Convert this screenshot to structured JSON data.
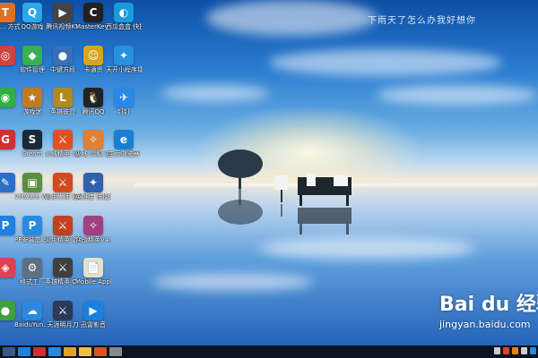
{
  "wallpaper_text": "下雨天了怎么办我好想你",
  "watermark": {
    "brand": "Bai du 经验",
    "site": "jingyan.baidu.com"
  },
  "desktop_icons": [
    {
      "label": "Tra... 方式",
      "color": "#e07020",
      "glyph": "T"
    },
    {
      "label": "QQ游戏",
      "color": "#2aa8e8",
      "glyph": "Q"
    },
    {
      "label": "腾讯视频KV",
      "color": "#444",
      "glyph": "▶"
    },
    {
      "label": "MasterKey 方式",
      "color": "#222",
      "glyph": "C"
    },
    {
      "label": "西瓜盒盒 快捷方式",
      "color": "#1a9ad9",
      "glyph": "◐"
    },
    {
      "label": "",
      "color": "#d04040",
      "glyph": "◎"
    },
    {
      "label": "软件管理",
      "color": "#38b050",
      "glyph": "◆"
    },
    {
      "label": "中键方段",
      "color": "#3a6fb6",
      "glyph": "●"
    },
    {
      "label": "卡通资",
      "color": "#d9a520",
      "glyph": "☺"
    },
    {
      "label": "天开小程序捷",
      "color": "#2890e0",
      "glyph": "✦"
    },
    {
      "label": "",
      "color": "#30b040",
      "glyph": "◉"
    },
    {
      "label": "游戏迷",
      "color": "#c07a20",
      "glyph": "★"
    },
    {
      "label": "英雄联盟",
      "color": "#b08a20",
      "glyph": "L"
    },
    {
      "label": "腾讯QQ",
      "color": "#222",
      "glyph": "🐧"
    },
    {
      "label": "钉钉",
      "color": "#2a88e8",
      "glyph": "✈"
    },
    {
      "label": "",
      "color": "#d03030",
      "glyph": "G"
    },
    {
      "label": "Steam",
      "color": "#1b2838",
      "glyph": "S"
    },
    {
      "label": "火线精英 (游戏)",
      "color": "#e05020",
      "glyph": "⚔"
    },
    {
      "label": "火线-灵狐 游戏图标",
      "color": "#e08030",
      "glyph": "✧"
    },
    {
      "label": "主页浏览器",
      "color": "#1a7fd4",
      "glyph": "e"
    },
    {
      "label": "",
      "color": "#2a70c8",
      "glyph": "✎"
    },
    {
      "label": "VMware Workst...",
      "color": "#5a8f40",
      "glyph": "▣"
    },
    {
      "label": "火炬大师 修改",
      "color": "#d04a20",
      "glyph": "⚔"
    },
    {
      "label": "英雄连 快捷方式",
      "color": "#3060b0",
      "glyph": "✦"
    },
    {
      "label": "",
      "color": "#2080e0",
      "glyph": "P"
    },
    {
      "label": "PP安装盒 3.0",
      "color": "#2a8ae0",
      "glyph": "P"
    },
    {
      "label": "火炬精英 游戏",
      "color": "#c04020",
      "glyph": "⚔"
    },
    {
      "label": "众战精英V4.23",
      "color": "#a04080",
      "glyph": "✧"
    },
    {
      "label": "",
      "color": "#e04050",
      "glyph": "◈"
    },
    {
      "label": "格式工厂",
      "color": "#607080",
      "glyph": "⚙"
    },
    {
      "label": "英雄精英 Online2",
      "color": "#404040",
      "glyph": "⚔"
    },
    {
      "label": "Mobile Applicatio...",
      "color": "#e8e0c0",
      "glyph": "📄"
    },
    {
      "label": "",
      "color": "#40a040",
      "glyph": "●"
    },
    {
      "label": "BaiduYun... 快捷方式",
      "color": "#2a88e0",
      "glyph": "☁"
    },
    {
      "label": "天涯明月刀",
      "color": "#2a3a58",
      "glyph": "⚔"
    },
    {
      "label": "迅雷影音",
      "color": "#1a80e0",
      "glyph": "▶"
    }
  ],
  "taskbar": {
    "buttons": [
      "#3a5a88",
      "#2080e0",
      "#d03030",
      "#2a88e0",
      "#e0a030",
      "#f0c040",
      "#e05020",
      "#888888"
    ],
    "tray": [
      "#cccccc",
      "#e04030",
      "#e08020",
      "#cccccc",
      "#2a88e0"
    ]
  }
}
